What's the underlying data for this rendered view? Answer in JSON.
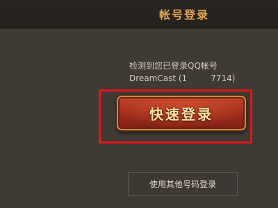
{
  "header": {
    "title": "帐号登录"
  },
  "info": {
    "line1": "检测到您已登录QQ帐号",
    "account_name": "DreamCast",
    "account_open": " (",
    "account_prefix": "1",
    "account_suffix": "7714)"
  },
  "buttons": {
    "quick_login": "快速登录",
    "other_login": "使用其他号码登录"
  }
}
